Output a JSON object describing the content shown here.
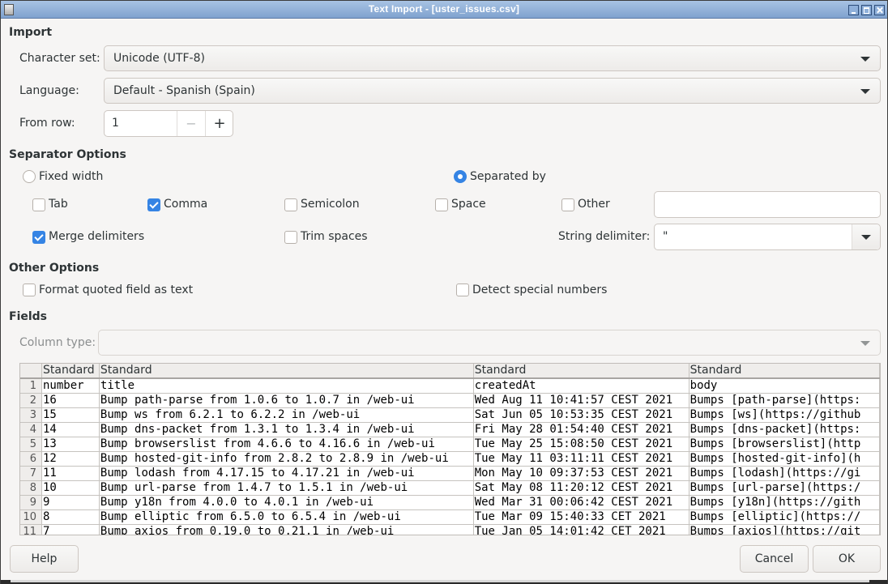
{
  "window": {
    "title": "Text Import - [uster_issues.csv]"
  },
  "import": {
    "section_title": "Import",
    "charset_label": "Character set:",
    "charset_value": "Unicode (UTF-8)",
    "language_label": "Language:",
    "language_value": "Default - Spanish (Spain)",
    "from_row_label": "From row:",
    "from_row_value": "1",
    "minus": "−",
    "plus": "+"
  },
  "separator": {
    "section_title": "Separator Options",
    "fixed_width_label": "Fixed width",
    "fixed_width_selected": false,
    "separated_by_label": "Separated by",
    "separated_by_selected": true,
    "tab_label": "Tab",
    "tab_checked": false,
    "comma_label": "Comma",
    "comma_checked": true,
    "semicolon_label": "Semicolon",
    "semicolon_checked": false,
    "space_label": "Space",
    "space_checked": false,
    "other_label": "Other",
    "other_checked": false,
    "other_value": "",
    "merge_label": "Merge delimiters",
    "merge_checked": true,
    "trim_label": "Trim spaces",
    "trim_checked": false,
    "string_delim_label": "String delimiter:",
    "string_delim_value": "\""
  },
  "other_options": {
    "section_title": "Other Options",
    "quoted_label": "Format quoted field as text",
    "quoted_checked": false,
    "special_label": "Detect special numbers",
    "special_checked": false
  },
  "fields": {
    "section_title": "Fields",
    "column_type_label": "Column type:",
    "column_type_value": "",
    "column_headers": [
      "Standard",
      "Standard",
      "Standard",
      "Standard"
    ],
    "rows": [
      {
        "n": "1",
        "cells": [
          "number",
          "title",
          "createdAt",
          "body"
        ]
      },
      {
        "n": "2",
        "cells": [
          "16",
          "Bump path-parse from 1.0.6 to 1.0.7 in /web-ui",
          "Wed Aug 11 10:41:57 CEST 2021",
          "Bumps [path-parse](https:"
        ]
      },
      {
        "n": "3",
        "cells": [
          "15",
          "Bump ws from 6.2.1 to 6.2.2 in /web-ui",
          "Sat Jun 05 10:53:35 CEST 2021",
          "Bumps [ws](https://github"
        ]
      },
      {
        "n": "4",
        "cells": [
          "14",
          "Bump dns-packet from 1.3.1 to 1.3.4 in /web-ui",
          "Fri May 28 01:54:40 CEST 2021",
          "Bumps [dns-packet](https:"
        ]
      },
      {
        "n": "5",
        "cells": [
          "13",
          "Bump browserslist from 4.6.6 to 4.16.6 in /web-ui",
          "Tue May 25 15:08:50 CEST 2021",
          "Bumps [browserslist](http"
        ]
      },
      {
        "n": "6",
        "cells": [
          "12",
          "Bump hosted-git-info from 2.8.2 to 2.8.9 in /web-ui",
          "Tue May 11 03:11:11 CEST 2021",
          "Bumps [hosted-git-info](h"
        ]
      },
      {
        "n": "7",
        "cells": [
          "11",
          "Bump lodash from 4.17.15 to 4.17.21 in /web-ui",
          "Mon May 10 09:37:53 CEST 2021",
          "Bumps [lodash](https://gi"
        ]
      },
      {
        "n": "8",
        "cells": [
          "10",
          "Bump url-parse from 1.4.7 to 1.5.1 in /web-ui",
          "Sat May 08 11:20:12 CEST 2021",
          "Bumps [url-parse](https:/"
        ]
      },
      {
        "n": "9",
        "cells": [
          "9",
          "Bump y18n from 4.0.0 to 4.0.1 in /web-ui",
          "Wed Mar 31 00:06:42 CEST 2021",
          "Bumps [y18n](https://gith"
        ]
      },
      {
        "n": "10",
        "cells": [
          "8",
          "Bump elliptic from 6.5.0 to 6.5.4 in /web-ui",
          "Tue Mar 09 15:40:33 CET 2021",
          "Bumps [elliptic](https://"
        ]
      },
      {
        "n": "11",
        "cells": [
          "7",
          "Bump axios from 0.19.0 to 0.21.1 in /web-ui",
          "Tue Jan 05 14:01:42 CET 2021",
          "Bumps [axios](https://git"
        ]
      }
    ]
  },
  "buttons": {
    "help": "Help",
    "cancel": "Cancel",
    "ok": "OK"
  },
  "colors": {
    "accent": "#3584e4",
    "titlebar": "#8fb0da",
    "dialog_bg": "#f6f5f4"
  }
}
